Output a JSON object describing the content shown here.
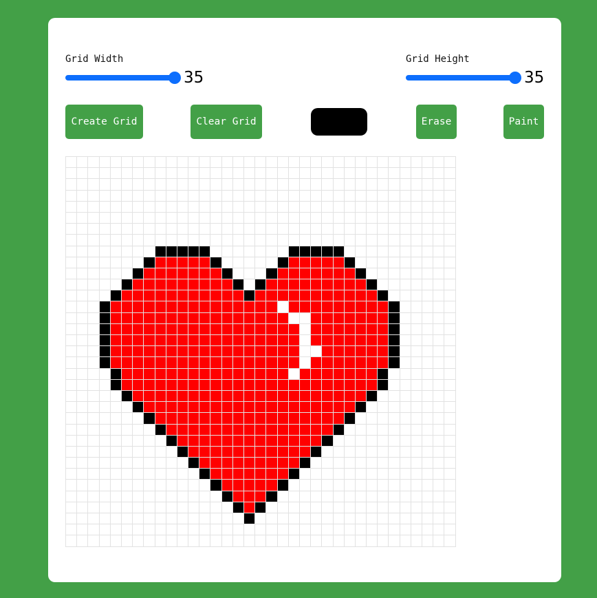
{
  "controls": {
    "width_label": "Grid Width",
    "width_value": "35",
    "height_label": "Grid Height",
    "height_value": "35",
    "create_label": "Create Grid",
    "clear_label": "Clear Grid",
    "erase_label": "Erase",
    "paint_label": "Paint",
    "selected_color": "#000000"
  },
  "colors": {
    "background": "#43a047",
    "button": "#43a047",
    "slider": "#0d6efd",
    "grid_line": "#e2e2e2",
    "palette": {
      "B": "#000000",
      "R": "#ff0000"
    }
  },
  "grid": {
    "cols": 35,
    "rows": 35,
    "pixels": [
      "...................................",
      "...................................",
      "...................................",
      "...................................",
      "...................................",
      "...................................",
      "...................................",
      "...................................",
      "........BBBBB.......BBBBB..........",
      ".......BRRRRRB.....BRRRRRB.........",
      "......BRRRRRRRB...BRRRRRRRB........",
      ".....BRRRRRRRRRB.BRRRRRRRRRB.......",
      "....BRRRRRRRRRRRBRRRRRRRRRRRB......",
      "...BRRRRRRRRRRRRRRR.RRRRRRRRRB.....",
      "...BRRRRRRRRRRRRRRRR..RRRRRRRB.....",
      "...BRRRRRRRRRRRRRRRRR.RRRRRRRB.....",
      "...BRRRRRRRRRRRRRRRRR.RRRRRRRB.....",
      "...BRRRRRRRRRRRRRRRRR..RRRRRRB.....",
      "...BRRRRRRRRRRRRRRRRR.RRRRRRRB.....",
      "....BRRRRRRRRRRRRRRR.RRRRRRRB......",
      "....BRRRRRRRRRRRRRRRRRRRRRRRB......",
      ".....BRRRRRRRRRRRRRRRRRRRRRB.......",
      "......BRRRRRRRRRRRRRRRRRRRB........",
      ".......BRRRRRRRRRRRRRRRRRB.........",
      "........BRRRRRRRRRRRRRRRB..........",
      ".........BRRRRRRRRRRRRRB...........",
      "..........BRRRRRRRRRRRB............",
      "...........BRRRRRRRRRB.............",
      "............BRRRRRRRB..............",
      ".............BRRRRRB...............",
      "..............BRRRB................",
      "...............BRB.................",
      "................B..................",
      "...................................",
      "..................................."
    ]
  }
}
